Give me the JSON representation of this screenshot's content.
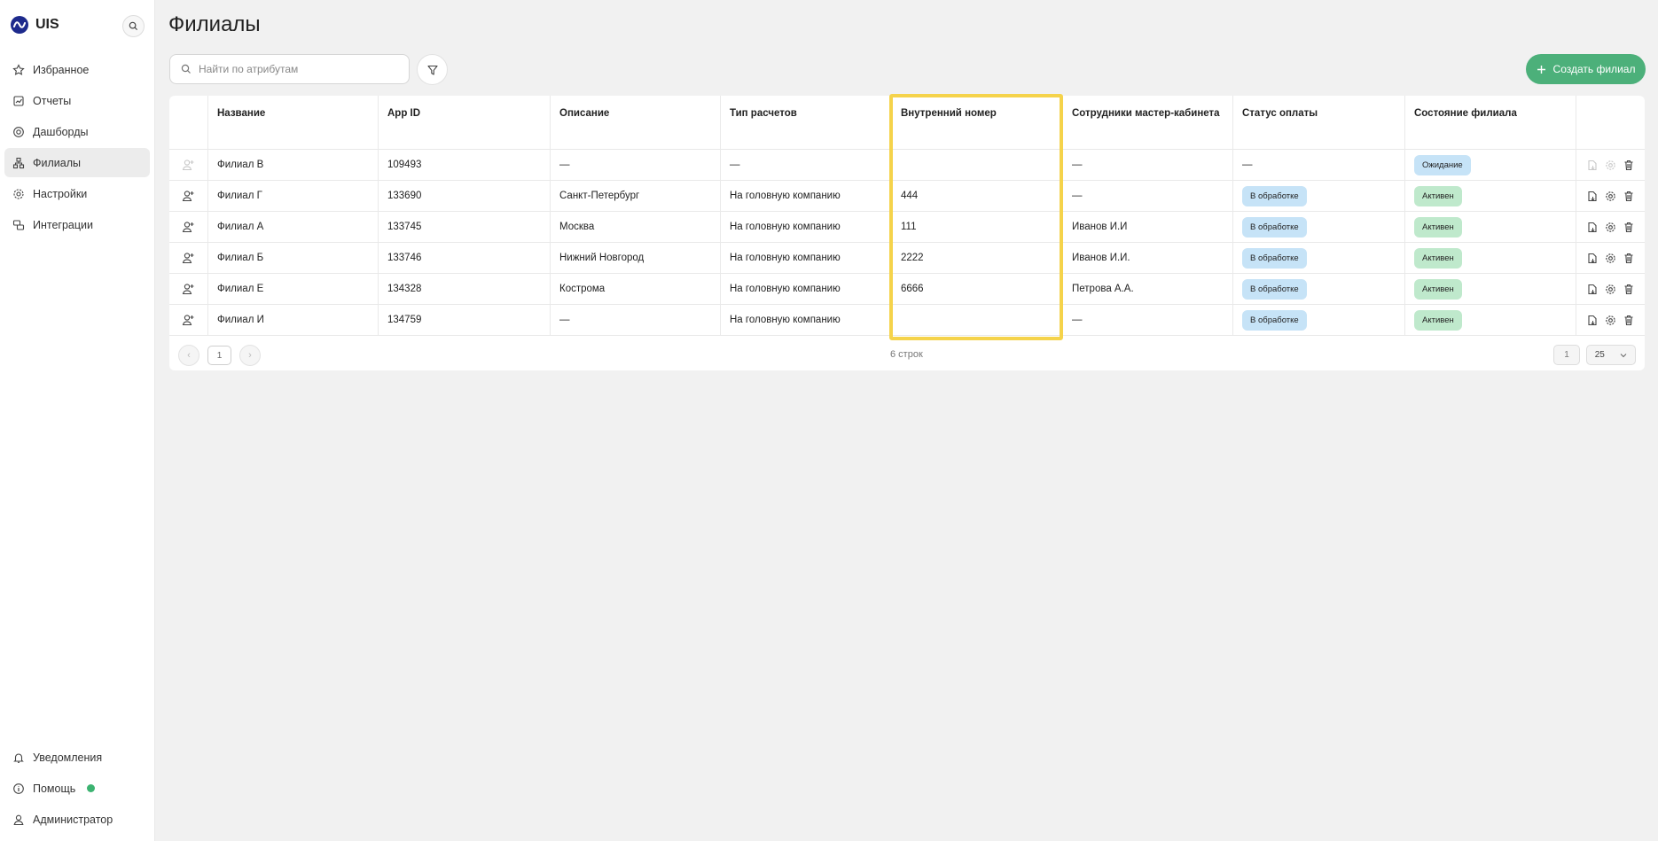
{
  "brand": {
    "name": "UIS"
  },
  "sidebar": {
    "items": [
      {
        "label": "Избранное",
        "icon": "star-icon"
      },
      {
        "label": "Отчеты",
        "icon": "report-icon"
      },
      {
        "label": "Дашборды",
        "icon": "dashboard-icon"
      },
      {
        "label": "Филиалы",
        "icon": "branches-icon",
        "active": true
      },
      {
        "label": "Настройки",
        "icon": "gear-icon"
      },
      {
        "label": "Интеграции",
        "icon": "integrations-icon"
      }
    ],
    "bottom": [
      {
        "label": "Уведомления",
        "icon": "bell-icon"
      },
      {
        "label": "Помощь",
        "icon": "info-icon"
      },
      {
        "label": "Администратор",
        "icon": "user-icon"
      }
    ]
  },
  "page": {
    "title": "Филиалы"
  },
  "search": {
    "placeholder": "Найти по атрибутам",
    "value": ""
  },
  "toolbar": {
    "create_label": "Создать филиал"
  },
  "table": {
    "columns": [
      "Название",
      "App ID",
      "Описание",
      "Тип расчетов",
      "Внутренний номер",
      "Сотрудники мастер-кабинета",
      "Статус оплаты",
      "Состояние филиала"
    ],
    "rows": [
      {
        "name": "Филиал В",
        "app_id": "109493",
        "desc": "—",
        "calc": "—",
        "internal": "",
        "staff": "—",
        "payment": "—",
        "state": "Ожидание",
        "disabled": true
      },
      {
        "name": "Филиал Г",
        "app_id": "133690",
        "desc": "Санкт-Петербург",
        "calc": "На головную компанию",
        "internal": "444",
        "staff": "—",
        "payment": "В обработке",
        "state": "Активен"
      },
      {
        "name": "Филиал А",
        "app_id": "133745",
        "desc": "Москва",
        "calc": "На головную компанию",
        "internal": "111",
        "staff": "Иванов И.И",
        "payment": "В обработке",
        "state": "Активен"
      },
      {
        "name": "Филиал Б",
        "app_id": "133746",
        "desc": "Нижний Новгород",
        "calc": "На головную компанию",
        "internal": "2222",
        "staff": "Иванов И.И.",
        "payment": "В обработке",
        "state": "Активен"
      },
      {
        "name": "Филиал Е",
        "app_id": "134328",
        "desc": "Кострома",
        "calc": "На головную компанию",
        "internal": "6666",
        "staff": "Петрова А.А.",
        "payment": "В обработке",
        "state": "Активен"
      },
      {
        "name": "Филиал И",
        "app_id": "134759",
        "desc": "—",
        "calc": "На головную компанию",
        "internal": "",
        "staff": "—",
        "payment": "В обработке",
        "state": "Активен"
      }
    ]
  },
  "footer": {
    "current_page": "1",
    "rows_count": "6 строк",
    "page_input": "1",
    "page_size": "25"
  },
  "colors": {
    "accent": "#4cb07a",
    "highlight": "#f5d34b",
    "badge_blue": "#c6e3f7",
    "badge_green": "#bfe9cc"
  }
}
